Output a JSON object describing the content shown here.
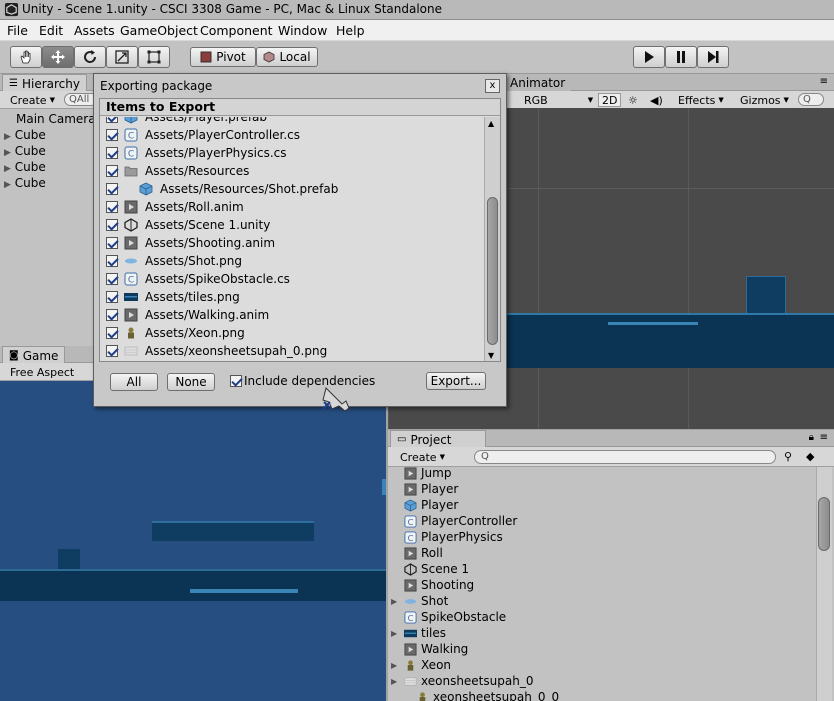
{
  "window": {
    "title": "Unity - Scene 1.unity - CSCI 3308 Game - PC, Mac & Linux Standalone"
  },
  "menu": [
    "File",
    "Edit",
    "Assets",
    "GameObject",
    "Component",
    "Window",
    "Help"
  ],
  "toolbar": {
    "tools": [
      "hand-tool",
      "move-tool",
      "rotate-tool",
      "scale-tool",
      "rect-tool"
    ],
    "pivot_label": "Pivot",
    "local_label": "Local"
  },
  "hierarchy": {
    "tab": "Hierarchy",
    "create_label": "Create",
    "search_placeholder": "All",
    "items": [
      {
        "label": "Main Camera",
        "expandable": false
      },
      {
        "label": "Cube",
        "expandable": true
      },
      {
        "label": "Cube",
        "expandable": true
      },
      {
        "label": "Cube",
        "expandable": true
      },
      {
        "label": "Cube",
        "expandable": true
      }
    ]
  },
  "game": {
    "tab": "Game",
    "aspect_label": "Free Aspect"
  },
  "scene": {
    "tab_animator": "Animator",
    "rgb_label": "RGB",
    "mode_2d": "2D",
    "effects_label": "Effects",
    "gizmos_label": "Gizmos"
  },
  "dialog": {
    "title": "Exporting package",
    "close": "x",
    "header": "Items to Export",
    "items": [
      {
        "label": "Assets/Player.prefab",
        "icon": "prefab-icon",
        "indent": false
      },
      {
        "label": "Assets/PlayerController.cs",
        "icon": "script-icon",
        "indent": false
      },
      {
        "label": "Assets/PlayerPhysics.cs",
        "icon": "script-icon",
        "indent": false
      },
      {
        "label": "Assets/Resources",
        "icon": "folder-icon",
        "indent": false
      },
      {
        "label": "Assets/Resources/Shot.prefab",
        "icon": "prefab-icon",
        "indent": true
      },
      {
        "label": "Assets/Roll.anim",
        "icon": "anim-icon",
        "indent": false
      },
      {
        "label": "Assets/Scene 1.unity",
        "icon": "unity-scene-icon",
        "indent": false
      },
      {
        "label": "Assets/Shooting.anim",
        "icon": "anim-icon",
        "indent": false
      },
      {
        "label": "Assets/Shot.png",
        "icon": "shot-image-icon",
        "indent": false
      },
      {
        "label": "Assets/SpikeObstacle.cs",
        "icon": "script-icon",
        "indent": false
      },
      {
        "label": "Assets/tiles.png",
        "icon": "tiles-image-icon",
        "indent": false
      },
      {
        "label": "Assets/Walking.anim",
        "icon": "anim-icon",
        "indent": false
      },
      {
        "label": "Assets/Xeon.png",
        "icon": "sprite-image-icon",
        "indent": false
      },
      {
        "label": "Assets/xeonsheetsupah_0.png",
        "icon": "sheet-image-icon",
        "indent": false
      }
    ],
    "all_label": "All",
    "none_label": "None",
    "include_dependencies_label": "Include dependencies",
    "export_label": "Export..."
  },
  "project": {
    "tab": "Project",
    "create_label": "Create",
    "items": [
      {
        "label": "Jump",
        "icon": "anim-icon",
        "expandable": false,
        "indent": false
      },
      {
        "label": "Player",
        "icon": "anim-controller-icon",
        "expandable": false,
        "indent": false
      },
      {
        "label": "Player",
        "icon": "prefab-icon",
        "expandable": false,
        "indent": false
      },
      {
        "label": "PlayerController",
        "icon": "script-icon",
        "expandable": false,
        "indent": false
      },
      {
        "label": "PlayerPhysics",
        "icon": "script-icon",
        "expandable": false,
        "indent": false
      },
      {
        "label": "Roll",
        "icon": "anim-icon",
        "expandable": false,
        "indent": false
      },
      {
        "label": "Scene 1",
        "icon": "unity-scene-icon",
        "expandable": false,
        "indent": false
      },
      {
        "label": "Shooting",
        "icon": "anim-icon",
        "expandable": false,
        "indent": false
      },
      {
        "label": "Shot",
        "icon": "shot-image-icon",
        "expandable": true,
        "indent": false
      },
      {
        "label": "SpikeObstacle",
        "icon": "script-icon",
        "expandable": false,
        "indent": false
      },
      {
        "label": "tiles",
        "icon": "tiles-image-icon",
        "expandable": true,
        "indent": false
      },
      {
        "label": "Walking",
        "icon": "anim-icon",
        "expandable": false,
        "indent": false
      },
      {
        "label": "Xeon",
        "icon": "sprite-image-icon",
        "expandable": true,
        "indent": false
      },
      {
        "label": "xeonsheetsupah_0",
        "icon": "sheet-image-icon",
        "expandable": true,
        "indent": false
      },
      {
        "label": "xeonsheetsupah_0_0",
        "icon": "sprite-image-icon",
        "expandable": false,
        "indent": true
      }
    ]
  },
  "colors": {
    "game_bg": "#274e80",
    "platform": "#0d3a5c",
    "scene_bg": "#4a4a4a",
    "checkbox_tick": "#1d3e86"
  }
}
